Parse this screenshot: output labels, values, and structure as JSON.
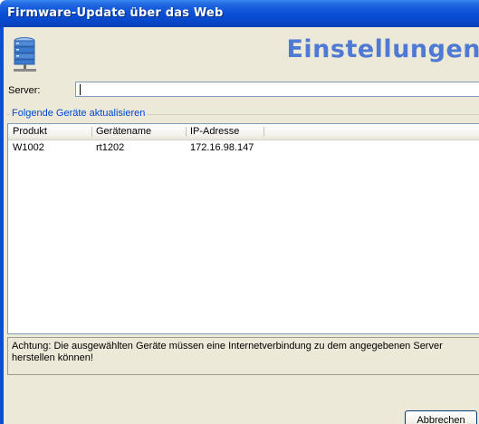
{
  "window": {
    "title": "Firmware-Update über das Web"
  },
  "header": {
    "title": "Einstellungen",
    "icon": "server-icon"
  },
  "server": {
    "label": "Server:",
    "value": ""
  },
  "group": {
    "legend": "Folgende Geräte aktualisieren"
  },
  "table": {
    "columns": [
      "Produkt",
      "Gerätename",
      "IP-Adresse"
    ],
    "rows": [
      [
        "W1002",
        "rt1202",
        "172.16.98.147"
      ]
    ]
  },
  "warning": {
    "text": "Achtung: Die ausgewählten Geräte müssen eine Internetverbindung zu dem angegebenen Server herstellen können!"
  },
  "buttons": {
    "cancel": "Abbrechen"
  },
  "colors": {
    "titlebar": "#0a4fd6",
    "header_title": "#4f7ad3",
    "legend": "#0046d5",
    "dialog_bg": "#ece9d8"
  }
}
